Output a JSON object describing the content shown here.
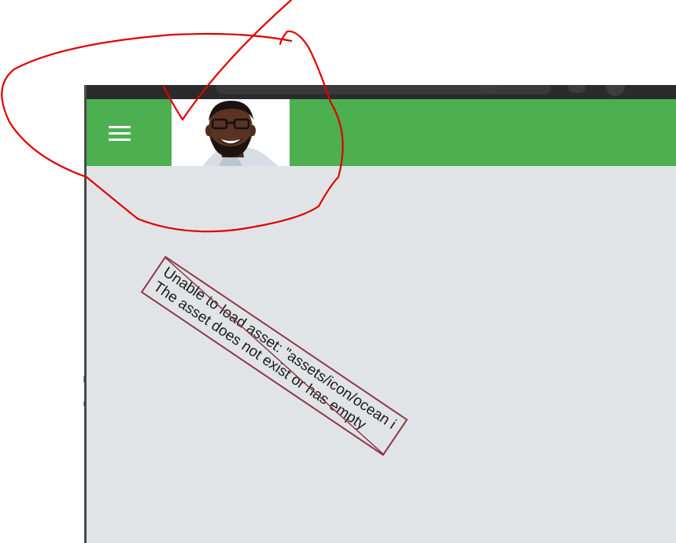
{
  "app_bar": {
    "color": "#4caf50",
    "menu_icon": "hamburger-menu-icon",
    "avatar_alt": "profile-photo"
  },
  "error": {
    "line1": "Unable to load asset: \"assets/icon/ocean i",
    "line2": "The asset does not exist or has empty",
    "border_color": "#8b3a4a"
  },
  "body": {
    "background": "#e1e4e6"
  },
  "annotation": {
    "stroke_color": "#e00000",
    "shapes": [
      "ellipse-circle",
      "checkmark"
    ]
  }
}
